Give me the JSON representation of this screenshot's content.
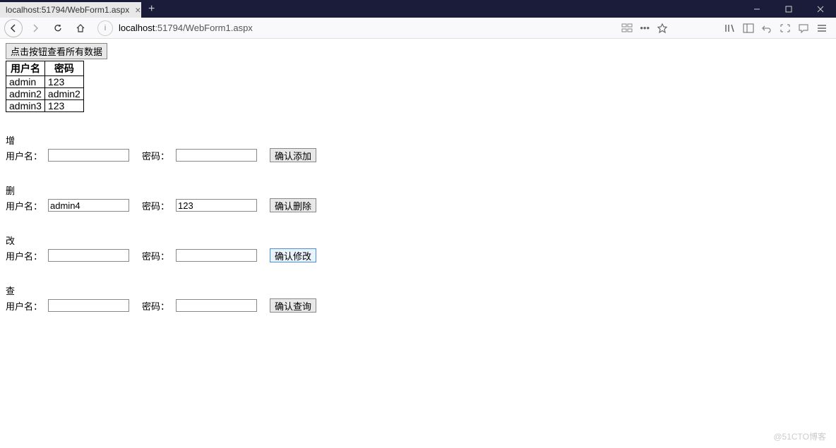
{
  "window": {
    "tab_title": "localhost:51794/WebForm1.aspx",
    "url_display_host": "localhost",
    "url_display_rest": ":51794/WebForm1.aspx"
  },
  "page": {
    "view_all_button": "点击按钮查看所有数据",
    "table": {
      "headers": [
        "用户名",
        "密码"
      ],
      "rows": [
        [
          "admin",
          "123"
        ],
        [
          "admin2",
          "admin2"
        ],
        [
          "admin3",
          "123"
        ]
      ]
    },
    "sections": {
      "add": {
        "title": "增",
        "user_label": "用户名：",
        "pwd_label": "密码：",
        "user_value": "",
        "pwd_value": "",
        "button": "确认添加"
      },
      "delete": {
        "title": "删",
        "user_label": "用户名：",
        "pwd_label": "密码：",
        "user_value": "admin4",
        "pwd_value": "123",
        "button": "确认删除"
      },
      "update": {
        "title": "改",
        "user_label": "用户名：",
        "pwd_label": "密码：",
        "user_value": "",
        "pwd_value": "",
        "button": "确认修改"
      },
      "query": {
        "title": "查",
        "user_label": "用户名：",
        "pwd_label": "密码：",
        "user_value": "",
        "pwd_value": "",
        "button": "确认查询"
      }
    }
  },
  "watermark": "@51CTO博客"
}
